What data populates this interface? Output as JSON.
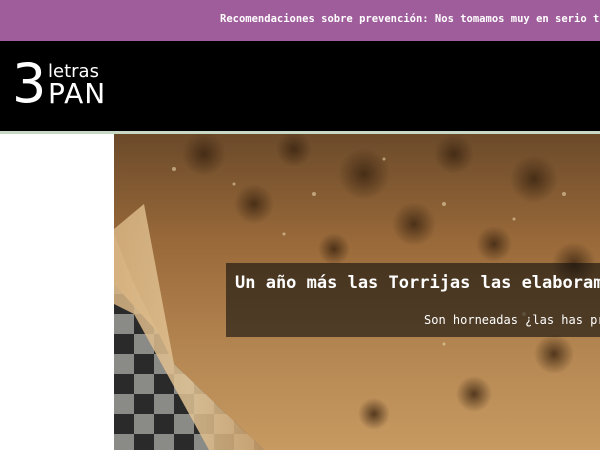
{
  "announcement": {
    "text": "Recomendaciones sobre prevención: Nos tomamos muy en serio tu salud y"
  },
  "logo": {
    "number": "3",
    "top_word": "letras",
    "bottom_word": "PAN"
  },
  "slider": {
    "title": "Un año más las Torrijas las elaboram",
    "subtitle": "Son horneadas ¿las has pr"
  },
  "colors": {
    "announcement_bg": "#a05d9c",
    "header_bg": "#000000",
    "accent_line": "#c7d9c4"
  }
}
